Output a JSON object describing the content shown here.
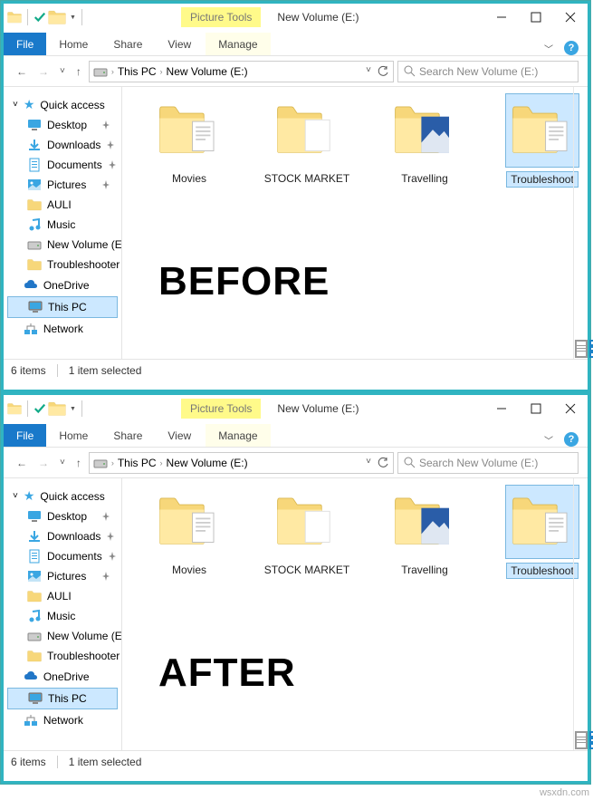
{
  "watermark": "wsxdn.com",
  "overlays": {
    "before": "BEFORE",
    "after": "AFTER"
  },
  "windows": [
    {
      "title": "New Volume (E:)",
      "picture_tools": "Picture Tools",
      "ribbon": {
        "file": "File",
        "tabs": [
          "Home",
          "Share",
          "View"
        ],
        "manage": "Manage"
      },
      "breadcrumb": {
        "root": "This PC",
        "loc": "New Volume (E:)"
      },
      "search_placeholder": "Search New Volume (E:)",
      "nav": {
        "quick": "Quick access",
        "items": [
          {
            "label": "Desktop",
            "pin": true
          },
          {
            "label": "Downloads",
            "pin": true
          },
          {
            "label": "Documents",
            "pin": true
          },
          {
            "label": "Pictures",
            "pin": true
          },
          {
            "label": "AULI",
            "pin": false
          },
          {
            "label": "Music",
            "pin": false
          },
          {
            "label": "New Volume (E:)",
            "pin": false
          },
          {
            "label": "Troubleshooter W",
            "pin": false
          }
        ],
        "onedrive": "OneDrive",
        "this_pc": "This PC",
        "network": "Network"
      },
      "folders": [
        {
          "name": "Movies",
          "type": "folder-docs"
        },
        {
          "name": "STOCK MARKET",
          "type": "folder-blank"
        },
        {
          "name": "Travelling",
          "type": "folder-photo"
        },
        {
          "name": "Troubleshoot",
          "type": "folder-docs",
          "selected": true
        }
      ],
      "status": {
        "items": "6 items",
        "selected": "1 item selected"
      }
    },
    {
      "title": "New Volume (E:)",
      "picture_tools": "Picture Tools",
      "ribbon": {
        "file": "File",
        "tabs": [
          "Home",
          "Share",
          "View"
        ],
        "manage": "Manage"
      },
      "breadcrumb": {
        "root": "This PC",
        "loc": "New Volume (E:)"
      },
      "search_placeholder": "Search New Volume (E:)",
      "nav": {
        "quick": "Quick access",
        "items": [
          {
            "label": "Desktop",
            "pin": true
          },
          {
            "label": "Downloads",
            "pin": true
          },
          {
            "label": "Documents",
            "pin": true
          },
          {
            "label": "Pictures",
            "pin": true
          },
          {
            "label": "AULI",
            "pin": false
          },
          {
            "label": "Music",
            "pin": false
          },
          {
            "label": "New Volume (E:)",
            "pin": false
          },
          {
            "label": "Troubleshooter W",
            "pin": false
          }
        ],
        "onedrive": "OneDrive",
        "this_pc": "This PC",
        "network": "Network"
      },
      "folders": [
        {
          "name": "Movies",
          "type": "folder-docs"
        },
        {
          "name": "STOCK MARKET",
          "type": "folder-blank"
        },
        {
          "name": "Travelling",
          "type": "folder-photo"
        },
        {
          "name": "Troubleshoot",
          "type": "folder-docs",
          "selected": true
        }
      ],
      "status": {
        "items": "6 items",
        "selected": "1 item selected"
      }
    }
  ]
}
